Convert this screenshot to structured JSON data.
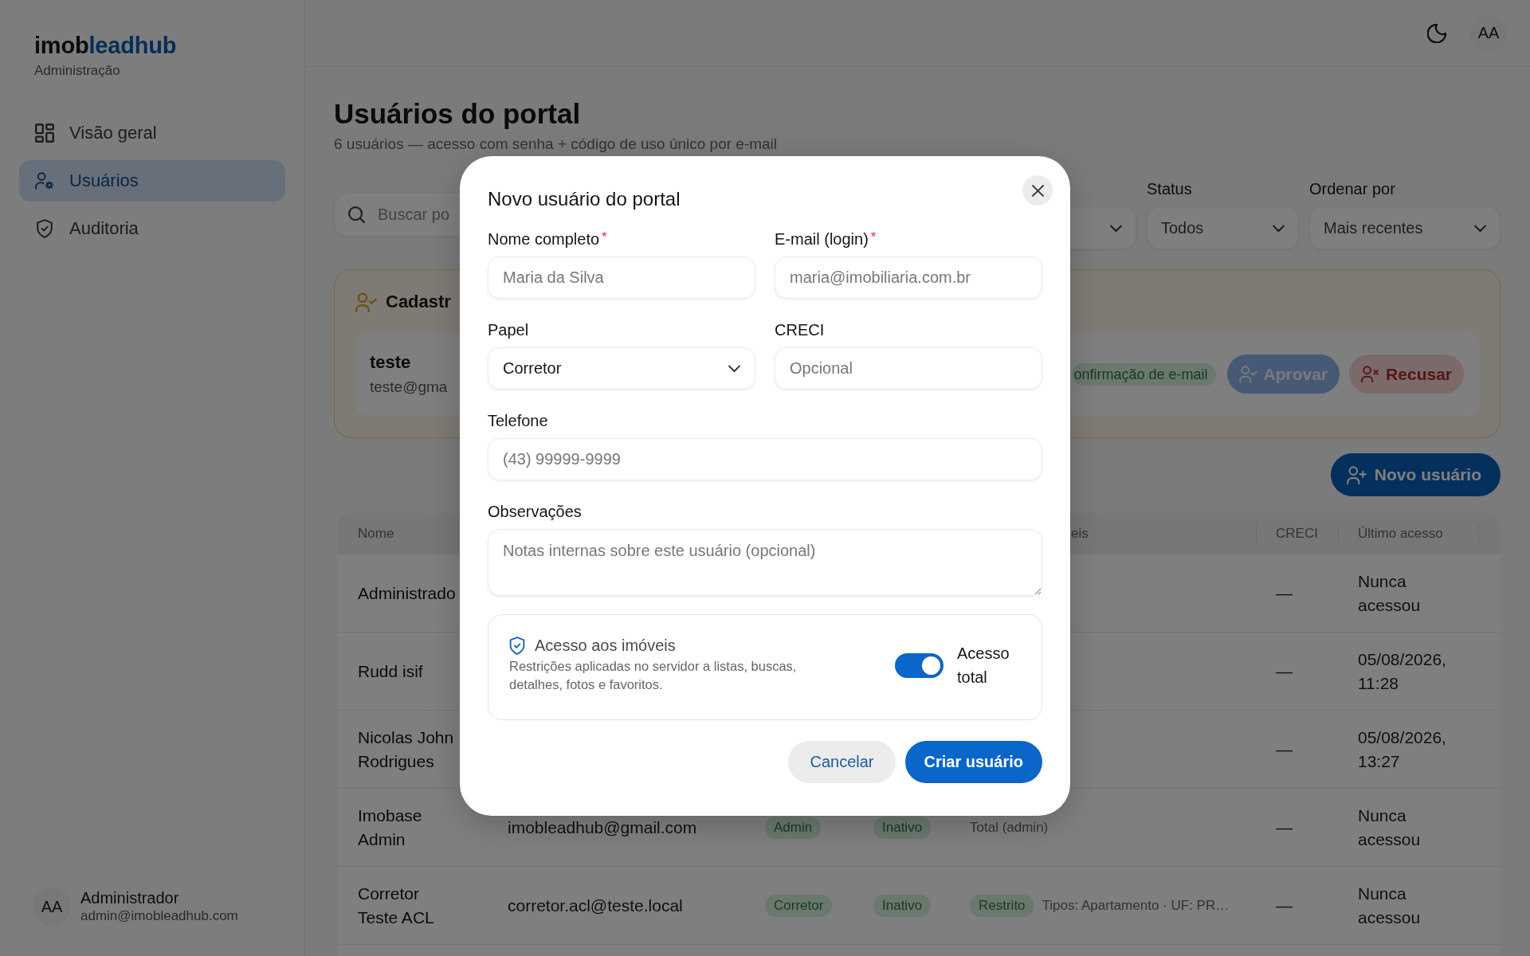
{
  "sidebar": {
    "logo": {
      "prefix": "imob",
      "suffix": "leadhub"
    },
    "subtitle": "Administração",
    "items": [
      {
        "label": "Visão geral",
        "selected": false
      },
      {
        "label": "Usuários",
        "selected": true
      },
      {
        "label": "Auditoria",
        "selected": false
      }
    ],
    "user": {
      "initials": "AA",
      "name": "Administrador",
      "email": "admin@imobleadhub.com"
    }
  },
  "topbar": {
    "avatar": "AA"
  },
  "page": {
    "title": "Usuários do portal",
    "subtitle": "6 usuários — acesso com senha + código de uso único por e-mail"
  },
  "search": {
    "placeholder": "Buscar po"
  },
  "filters": [
    {
      "kind": "covered"
    },
    {
      "kind": "select",
      "label": "Status",
      "value": "Todos"
    },
    {
      "kind": "select",
      "label": "Ordenar por",
      "value": "Mais recentes"
    }
  ],
  "pending": {
    "title": "Cadastr",
    "items": [
      {
        "name": "teste",
        "email": "teste@gma",
        "badge": "onfirmação de e-mail",
        "actions": [
          {
            "kind": "approve",
            "label": "Aprovar"
          },
          {
            "kind": "reject",
            "label": "Recusar"
          }
        ]
      }
    ]
  },
  "new_user_button": "Novo usuário",
  "table": {
    "columns": [
      {
        "kind": "text",
        "label": "Nome"
      },
      {
        "kind": "covered"
      },
      {
        "kind": "covered"
      },
      {
        "kind": "covered"
      },
      {
        "kind": "partial",
        "label": "eis"
      },
      {
        "kind": "text",
        "label": "CRECI"
      },
      {
        "kind": "text",
        "label": "Último acesso"
      }
    ],
    "rows": [
      {
        "name": "Administrado",
        "creci": "—",
        "last_access": "Nunca acessou"
      },
      {
        "name": "Rudd isif",
        "creci": "—",
        "last_access": "05/08/2026, 11:28"
      },
      {
        "name": "Nicolas John Rodrigues",
        "creci": "—",
        "last_access": "05/08/2026, 13:27"
      },
      {
        "name": "Imobase Admin",
        "email": "imobleadhub@gmail.com",
        "role": "Admin",
        "status": "Inativo",
        "access": {
          "text": "Total (admin)"
        },
        "creci": "—",
        "last_access": "Nunca acessou"
      },
      {
        "name": "Corretor Teste ACL",
        "email": "corretor.acl@teste.local",
        "role": "Corretor",
        "status": "Inativo",
        "access": {
          "badge": "Restrito",
          "text": "Tipos: Apartamento · UF: PR…"
        },
        "creci": "—",
        "last_access": "Nunca acessou"
      }
    ]
  },
  "modal": {
    "title": "Novo usuário do portal",
    "field_rows": [
      [
        {
          "kind": "input",
          "label": "Nome completo",
          "required_mark": "*",
          "placeholder": "Maria da Silva"
        },
        {
          "kind": "input",
          "label": "E-mail (login)",
          "required_mark": "*",
          "placeholder": "maria@imobiliaria.com.br"
        }
      ],
      [
        {
          "kind": "select",
          "label": "Papel",
          "value": "Corretor"
        },
        {
          "kind": "input",
          "label": "CRECI",
          "placeholder": "Opcional"
        }
      ],
      [
        {
          "kind": "input",
          "label": "Telefone",
          "placeholder": "(43) 99999-9999"
        }
      ],
      [
        {
          "kind": "textarea",
          "label": "Observações",
          "placeholder": "Notas internas sobre este usuário (opcional)"
        }
      ]
    ],
    "access": {
      "title": "Acesso aos imóveis",
      "description": "Restrições aplicadas no servidor a listas, buscas, detalhes, fotos e favoritos.",
      "toggle": {
        "label": "Acesso total",
        "on": true
      }
    },
    "buttons": [
      {
        "kind": "secondary",
        "label": "Cancelar"
      },
      {
        "kind": "primary",
        "label": "Criar usuário"
      }
    ]
  }
}
